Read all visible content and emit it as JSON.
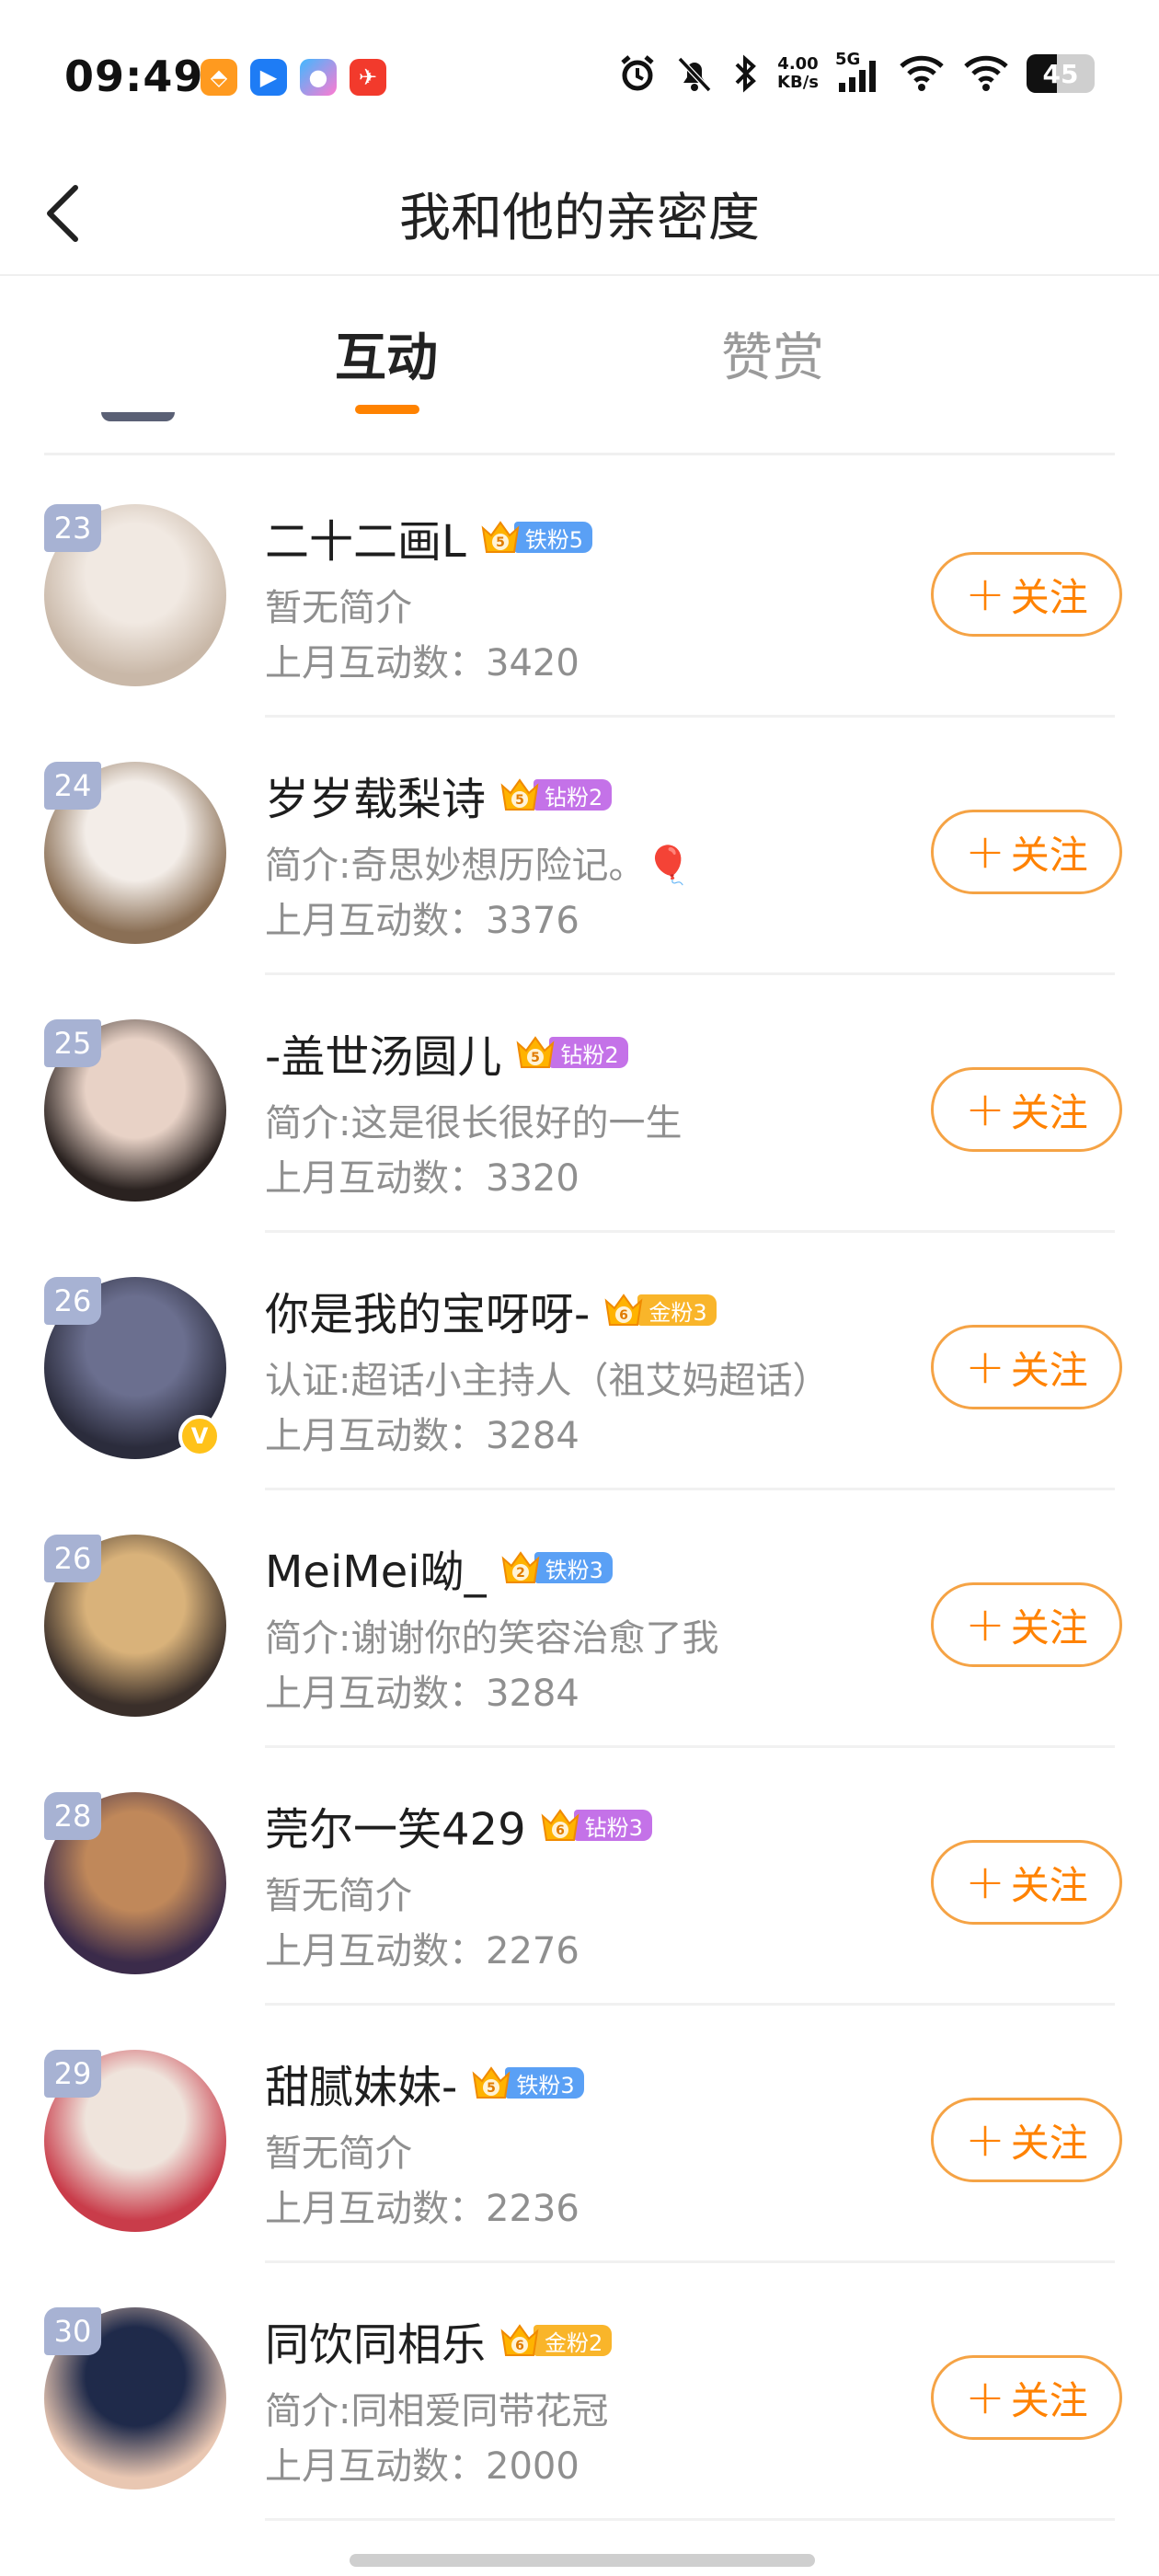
{
  "status_bar": {
    "time": "09:49",
    "speed_value": "4.00",
    "speed_unit": "KB/s",
    "network": "5G",
    "battery": "45",
    "battery_level": 0.45
  },
  "header": {
    "title": "我和他的亲密度"
  },
  "tabs": [
    {
      "label": "互动",
      "active": true
    },
    {
      "label": "赞赏",
      "active": false
    }
  ],
  "follow_label": "关注",
  "rows": [
    {
      "rank": "23",
      "name": "二十二画L",
      "fan_label": "铁粉5",
      "fan_level": "5",
      "fan_tier": "iron",
      "intro": "暂无简介",
      "count": "上月互动数：3420",
      "avatar_colors": [
        "#f1e9e2",
        "#c9b8a8"
      ],
      "verified": false
    },
    {
      "rank": "24",
      "name": "岁岁载梨诗",
      "fan_label": "钻粉2",
      "fan_level": "5",
      "fan_tier": "diamond",
      "intro": "简介:奇思妙想历险记。🎈",
      "count": "上月互动数：3376",
      "avatar_colors": [
        "#f3ede8",
        "#8a6f55"
      ],
      "verified": false
    },
    {
      "rank": "25",
      "name": "-盖世汤圆儿",
      "fan_label": "钻粉2",
      "fan_level": "5",
      "fan_tier": "diamond",
      "intro": "简介:这是很长很好的一生",
      "count": "上月互动数：3320",
      "avatar_colors": [
        "#e8d2c6",
        "#2a2220"
      ],
      "verified": false
    },
    {
      "rank": "26",
      "name": "你是我的宝呀呀-",
      "fan_label": "金粉3",
      "fan_level": "6",
      "fan_tier": "gold",
      "intro": "认证:超话小主持人（祖艾妈超话）",
      "count": "上月互动数：3284",
      "avatar_colors": [
        "#6b6f8f",
        "#2b2c3c"
      ],
      "verified": true
    },
    {
      "rank": "26",
      "name": "MeiMei呦_",
      "fan_label": "铁粉3",
      "fan_level": "2",
      "fan_tier": "iron",
      "intro": "简介:谢谢你的笑容治愈了我",
      "count": "上月互动数：3284",
      "avatar_colors": [
        "#d9b27a",
        "#3a2f2a"
      ],
      "verified": false
    },
    {
      "rank": "28",
      "name": "莞尔一笑429",
      "fan_label": "钻粉3",
      "fan_level": "6",
      "fan_tier": "diamond",
      "intro": "暂无简介",
      "count": "上月互动数：2276",
      "avatar_colors": [
        "#c0885a",
        "#3b2b4a"
      ],
      "verified": false
    },
    {
      "rank": "29",
      "name": "甜腻妹妹-",
      "fan_label": "铁粉3",
      "fan_level": "5",
      "fan_tier": "iron",
      "intro": "暂无简介",
      "count": "上月互动数：2236",
      "avatar_colors": [
        "#efe4dc",
        "#c93c4a"
      ],
      "verified": false
    },
    {
      "rank": "30",
      "name": "同饮同相乐",
      "fan_label": "金粉2",
      "fan_level": "6",
      "fan_tier": "gold",
      "intro": "简介:同相爱同带花冠",
      "count": "上月互动数：2000",
      "avatar_colors": [
        "#1f2a4a",
        "#e9c7b2"
      ],
      "verified": false
    }
  ]
}
